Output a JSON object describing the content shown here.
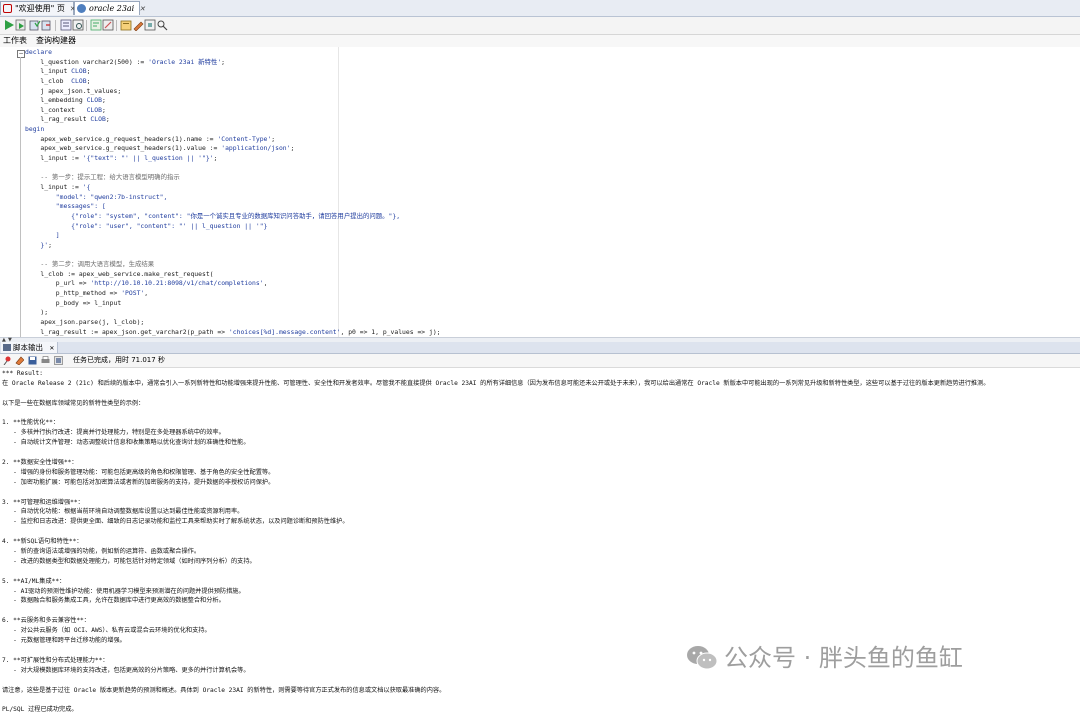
{
  "tabs": [
    {
      "label": "\"欢迎使用\" 页",
      "active": false
    },
    {
      "label": "oracle 23ai",
      "active": true
    }
  ],
  "toolbar_icons": [
    "run-statement-icon",
    "run-script-icon",
    "commit-icon",
    "rollback-icon",
    "sql-tuning-icon",
    "autotrace-icon",
    "explain-plan-icon",
    "clear-icon",
    "history-icon",
    "format-icon",
    "unshared-sql-icon",
    "find-icon"
  ],
  "worksheet_tabs": [
    "工作表",
    "查询构建器"
  ],
  "code_lines": [
    [
      [
        "declare",
        "kw"
      ]
    ],
    [
      [
        "    l_question varchar2(500) := ",
        ""
      ],
      [
        "'Oracle 23ai 新特性'",
        "str"
      ],
      [
        ";",
        ""
      ]
    ],
    [
      [
        "    l_input ",
        ""
      ],
      [
        "CLOB",
        "kw"
      ],
      [
        ";",
        ""
      ]
    ],
    [
      [
        "    l_clob  ",
        ""
      ],
      [
        "CLOB",
        "kw"
      ],
      [
        ";",
        ""
      ]
    ],
    [
      [
        "    j apex_json.t_values;",
        ""
      ]
    ],
    [
      [
        "    l_embedding ",
        ""
      ],
      [
        "CLOB",
        "kw"
      ],
      [
        ";",
        ""
      ]
    ],
    [
      [
        "    l_context   ",
        ""
      ],
      [
        "CLOB",
        "kw"
      ],
      [
        ";",
        ""
      ]
    ],
    [
      [
        "    l_rag_result ",
        ""
      ],
      [
        "CLOB",
        "kw"
      ],
      [
        ";",
        ""
      ]
    ],
    [
      [
        "begin",
        "kw"
      ]
    ],
    [
      [
        "    apex_web_service.g_request_headers(1).name := ",
        ""
      ],
      [
        "'Content-Type'",
        "str"
      ],
      [
        ";",
        ""
      ]
    ],
    [
      [
        "    apex_web_service.g_request_headers(1).value := ",
        ""
      ],
      [
        "'application/json'",
        "str"
      ],
      [
        ";",
        ""
      ]
    ],
    [
      [
        "    l_input := ",
        ""
      ],
      [
        "'{\"text\": \"' || l_question || '\"}'",
        "str"
      ],
      [
        ";",
        ""
      ]
    ],
    [
      [
        "",
        ""
      ]
    ],
    [
      [
        "    -- 第一步：提示工程：给大语言模型明确的指示",
        "cm"
      ]
    ],
    [
      [
        "    l_input := ",
        ""
      ],
      [
        "'{",
        "str"
      ]
    ],
    [
      [
        "        \"model\": \"qwen2:7b-instruct\",",
        "str"
      ]
    ],
    [
      [
        "        \"messages\": [",
        "str"
      ]
    ],
    [
      [
        "            {\"role\": \"system\", \"content\": \"你是一个诚实且专业的数据库知识问答助手，请回答用户提出的问题。\"},",
        "str"
      ]
    ],
    [
      [
        "            {\"role\": \"user\", \"content\": \"' || l_question || '\"}",
        "str"
      ]
    ],
    [
      [
        "        ]",
        "str"
      ]
    ],
    [
      [
        "    }'",
        "str"
      ],
      [
        ";",
        ""
      ]
    ],
    [
      [
        "",
        ""
      ]
    ],
    [
      [
        "    -- 第二步：调用大语言模型，生成结果",
        "cm"
      ]
    ],
    [
      [
        "    l_clob := apex_web_service.make_rest_request(",
        ""
      ]
    ],
    [
      [
        "        p_url => ",
        ""
      ],
      [
        "'http://10.10.10.21:8098/v1/chat/completions'",
        "str"
      ],
      [
        ",",
        ""
      ]
    ],
    [
      [
        "        p_http_method => ",
        ""
      ],
      [
        "'POST'",
        "str"
      ],
      [
        ",",
        ""
      ]
    ],
    [
      [
        "        p_body => l_input",
        ""
      ]
    ],
    [
      [
        "    );",
        ""
      ]
    ],
    [
      [
        "    apex_json.parse(j, l_clob);",
        ""
      ]
    ],
    [
      [
        "    l_rag_result := apex_json.get_varchar2(p_path => ",
        ""
      ],
      [
        "'choices[%d].message.content'",
        "str"
      ],
      [
        ", p0 => 1, p_values => j);",
        ""
      ]
    ]
  ],
  "output_panel": {
    "tab_label": "脚本输出",
    "status": "任务已完成，用时 71.017 秒",
    "icons": [
      "pin-icon",
      "eraser-icon",
      "save-icon",
      "print-icon",
      "export-icon"
    ]
  },
  "output_lines": [
    "*** Result:",
    "在 Oracle Release 2 (21c) 和后续的版本中，通常会引入一系列新特性和功能增强来提升性能、可管理性、安全性和开发者效率。尽管我不能直接提供 Oracle 23AI 的所有详细信息（因为发布信息可能还未公开或处于未来），我可以给出通常在 Oracle 新版本中可能出现的一系列常见升级和新特性类型，这些可以基于过往的版本更新趋势进行推测。",
    "",
    "以下是一些在数据库领域常见的新特性类型的示例：",
    "",
    "1. **性能优化**：",
    "   - 多核并行执行改进：提高并行处理能力，特别是在多处理器系统中的效率。",
    "   - 自动统计文件管理：动态调整统计信息和收集策略以优化查询计划的准确性和性能。",
    "",
    "2. **数据安全性增强**：",
    "   - 增强的身份和服务管理功能：可能包括更高级的角色和权限管理、基于角色的安全性配置等。",
    "   - 加密功能扩展：可能包括对加密算法或者新的加密服务的支持，提升数据的非授权访问保护。",
    "",
    "3. **可管理和运维增强**：",
    "   - 自动优化功能：根据当前环境自动调整数据库设置以达到最佳性能或资源利用率。",
    "   - 监控和日志改进：提供更全面、细致的日志记录功能和监控工具来帮助实时了解系统状态，以及问题诊断和预防性维护。",
    "",
    "4. **新SQL语句和特性**：",
    "   - 新的查询语法或增强的功能，例如新的运算符、函数或聚合操作。",
    "   - 改进的数据类型和数据处理能力，可能包括针对特定领域（如时间序列分析）的支持。",
    "",
    "5. **AI/ML集成**：",
    "   - AI驱动的预测性维护功能：使用机器学习模型来预测潜在的问题并提供预防措施。",
    "   - 数据融合和服务集成工具，允许在数据库中进行更高效的数据整合和分析。",
    "",
    "6. **云服务和多云兼容性**：",
    "   - 对公共云服务（如 OCI、AWS）、私有云或混合云环境的优化和支持。",
    "   - 元数据管理和跨平台迁移功能的增强。",
    "",
    "7. **可扩展性和分布式处理能力**：",
    "   - 对大规模数据库环境的支持改进，包括更高效的分片策略、更多的并行计算机会等。",
    "",
    "请注意，这些是基于过往 Oracle 版本更新趋势的预测和概述。具体到 Oracle 23AI 的新特性，则需要等待官方正式发布的信息或文档以获取最准确的内容。",
    "",
    "PL/SQL 过程已成功完成。"
  ],
  "watermark": {
    "text": "公众号 · 胖头鱼的鱼缸"
  }
}
